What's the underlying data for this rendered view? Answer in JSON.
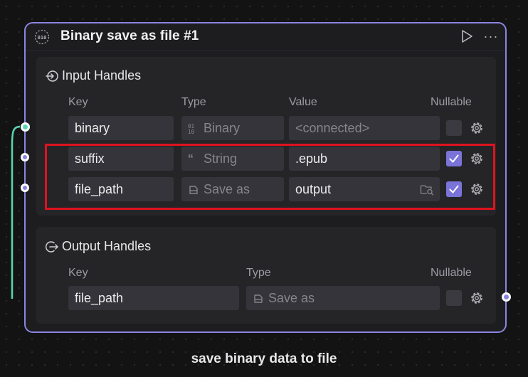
{
  "node": {
    "title": "Binary save as file #1",
    "icon": "node-binary-icon",
    "actions": {
      "run_icon": "play-icon",
      "more_label": "···"
    }
  },
  "input_handles": {
    "title": "Input Handles",
    "columns": {
      "key": "Key",
      "type": "Type",
      "value": "Value",
      "nullable": "Nullable"
    },
    "rows": [
      {
        "key": "binary",
        "type": "Binary",
        "type_icon": "binary-icon",
        "value": "<connected>",
        "nullable": false
      },
      {
        "key": "suffix",
        "type": "String",
        "type_icon": "quote-icon",
        "value": ".epub",
        "nullable": true
      },
      {
        "key": "file_path",
        "type": "Save as",
        "type_icon": "save-icon",
        "value": "output",
        "nullable": true,
        "value_icon": "folder-search-icon"
      }
    ]
  },
  "output_handles": {
    "title": "Output Handles",
    "columns": {
      "key": "Key",
      "type": "Type",
      "nullable": "Nullable"
    },
    "rows": [
      {
        "key": "file_path",
        "type": "Save as",
        "type_icon": "save-icon",
        "nullable": false
      }
    ]
  },
  "caption": "save binary data to file",
  "colors": {
    "accent": "#8b85e0",
    "connected": "#5ad6b0",
    "highlight": "#e0121f"
  }
}
